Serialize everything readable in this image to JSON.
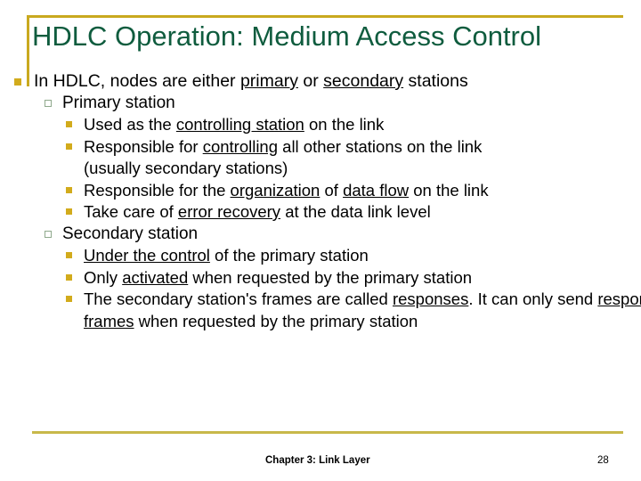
{
  "slide": {
    "title": "HDLC Operation: Medium Access Control",
    "accent_gold": "#c9a91f",
    "accent_gold_bottom": "#c8b84a",
    "title_color": "#0f5c3e",
    "bullet_fill_color": "#d2ab1c",
    "bullet_outline_color": "#8fa98c",
    "body_text_color": "#000000"
  },
  "body": {
    "l1": {
      "pre": "In HDLC, nodes are either ",
      "u1": "primary",
      "mid": " or ",
      "u2": "secondary",
      "post": " stations"
    },
    "l2a": {
      "text": "Primary station"
    },
    "l3a": {
      "pre": "Used as the ",
      "u1": "controlling station",
      "post": " on the link"
    },
    "l3b": {
      "pre": "Responsible for ",
      "u1": "controlling",
      "post": " all other stations on the link",
      "cont": "(usually secondary stations)"
    },
    "l3c": {
      "pre": "Responsible for the ",
      "u1": "organization",
      "mid": " of ",
      "u2": "data flow",
      "post": " on the link"
    },
    "l3d": {
      "pre": "Take care of ",
      "u1": "error recovery",
      "post": " at the data link level"
    },
    "l2b": {
      "text": "Secondary station"
    },
    "l3e": {
      "u1": "Under the control",
      "post": " of the primary station"
    },
    "l3f": {
      "pre": "Only ",
      "u1": "activated",
      "post": " when requested by the primary station"
    },
    "l3g": {
      "pre": "The secondary station's frames are called ",
      "u1": "responses",
      "post": ". It can only send ",
      "u2": "response frames",
      "post2": " when requested by the primary station"
    }
  },
  "footer": {
    "chapter": "Chapter 3: Link Layer",
    "page": "28"
  }
}
